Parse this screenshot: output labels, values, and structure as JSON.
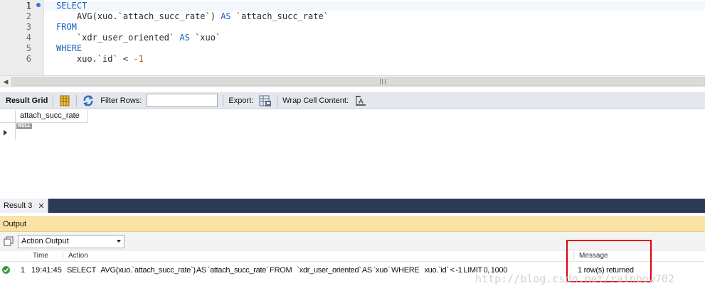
{
  "editor": {
    "lines": [
      {
        "no": "1",
        "parts": [
          {
            "t": "SELECT",
            "c": "kw"
          }
        ]
      },
      {
        "no": "2",
        "parts": [
          {
            "t": "    AVG(xuo.`attach_succ_rate`) ",
            "c": "txt"
          },
          {
            "t": "AS",
            "c": "kw"
          },
          {
            "t": " `attach_succ_rate`",
            "c": "txt"
          }
        ]
      },
      {
        "no": "3",
        "parts": [
          {
            "t": "FROM",
            "c": "kw"
          }
        ]
      },
      {
        "no": "4",
        "parts": [
          {
            "t": "    `xdr_user_oriented` ",
            "c": "txt"
          },
          {
            "t": "AS",
            "c": "kw"
          },
          {
            "t": " `xuo`",
            "c": "txt"
          }
        ]
      },
      {
        "no": "5",
        "parts": [
          {
            "t": "WHERE",
            "c": "kw"
          }
        ]
      },
      {
        "no": "6",
        "parts": [
          {
            "t": "    xuo.`id` < ",
            "c": "txt"
          },
          {
            "t": "-1",
            "c": "num"
          }
        ]
      }
    ]
  },
  "toolbar": {
    "result_grid_label": "Result Grid",
    "filter_rows_label": "Filter Rows:",
    "filter_value": "",
    "export_label": "Export:",
    "wrap_label": "Wrap Cell Content:"
  },
  "grid": {
    "column": "attach_succ_rate",
    "null_label": "NULL"
  },
  "tabs": {
    "result_tab": "Result 3",
    "close_glyph": "✕"
  },
  "output": {
    "title": "Output",
    "select_value": "Action Output",
    "columns": {
      "time": "Time",
      "action": "Action",
      "message": "Message"
    },
    "rows": [
      {
        "index": "1",
        "time": "19:41:45",
        "action": "SELECT    AVG(xuo.`attach_succ_rate`) AS `attach_succ_rate` FROM    `xdr_user_oriented` AS `xuo` WHERE    xuo.`id` < -1 LIMIT 0, 1000",
        "message": "1 row(s) returned"
      }
    ]
  },
  "watermark": "http://blog.csdn.net/rainbow702",
  "colors": {
    "keyword": "#1c62b9",
    "number": "#d04a1a",
    "output_header": "#fbe3a5",
    "tab_bar": "#2b3a57",
    "success": "#2d9a3c",
    "highlight": "#e00010"
  }
}
